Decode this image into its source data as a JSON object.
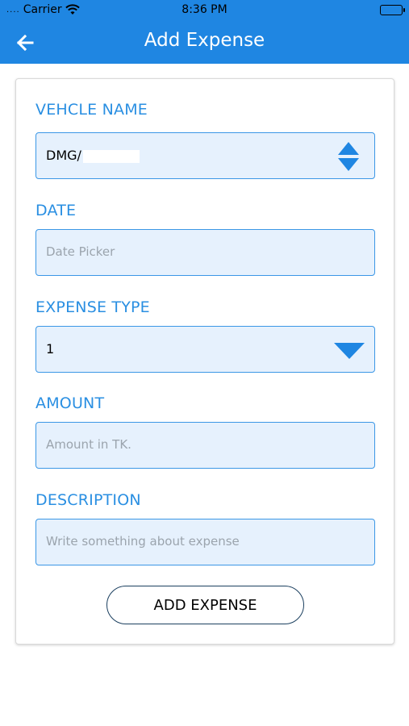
{
  "status_bar": {
    "dots": "....",
    "carrier": "Carrier",
    "time": "8:36 PM"
  },
  "navbar": {
    "title": "Add Expense",
    "back_icon": "arrow-left-icon"
  },
  "form": {
    "vehicle": {
      "label": "VEHCLE NAME",
      "value": "DMG/"
    },
    "date": {
      "label": "DATE",
      "placeholder": "Date Picker"
    },
    "expense_type": {
      "label": "EXPENSE TYPE",
      "value": "1"
    },
    "amount": {
      "label": "AMOUNT",
      "placeholder": "Amount in TK."
    },
    "description": {
      "label": "DESCRIPTION",
      "placeholder": "Write something about expense"
    },
    "submit_label": "ADD EXPENSE"
  },
  "colors": {
    "primary": "#1f86e2",
    "label": "#2a8fe2",
    "field_bg": "#e6f1fd",
    "field_border": "#3b97e6"
  }
}
